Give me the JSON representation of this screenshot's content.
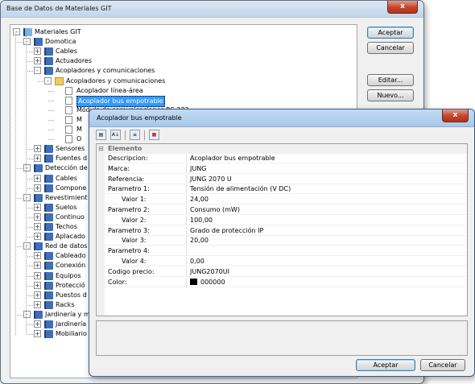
{
  "main_window": {
    "title": "Base de Datos de Materiales GIT",
    "close": "x",
    "buttons": {
      "accept": "Aceptar",
      "cancel": "Cancelar",
      "edit": "Editar...",
      "new": "Nuevo..."
    }
  },
  "tree": [
    {
      "label": "Materiales GIT",
      "level": 0,
      "icon": "root-book",
      "exp": "-"
    },
    {
      "label": "Domotica",
      "level": 1,
      "icon": "book",
      "exp": "-"
    },
    {
      "label": "Cables",
      "level": 2,
      "icon": "book",
      "exp": "+"
    },
    {
      "label": "Actuadores",
      "level": 2,
      "icon": "book",
      "exp": "+"
    },
    {
      "label": "Acopladores y comunicaciones",
      "level": 2,
      "icon": "book",
      "exp": "-"
    },
    {
      "label": "Acopladores y comunicaciones",
      "level": 3,
      "icon": "folder",
      "exp": "-"
    },
    {
      "label": "Acoplador línea-área",
      "level": 4,
      "icon": "doc",
      "exp": ""
    },
    {
      "label": "Acoplador bus empotrable",
      "level": 4,
      "icon": "doc",
      "exp": "",
      "selected": true
    },
    {
      "label": "Módulo de comunicaciones RS 232",
      "level": 4,
      "icon": "doc",
      "exp": ""
    },
    {
      "label": "M",
      "level": 4,
      "icon": "doc",
      "exp": ""
    },
    {
      "label": "M",
      "level": 4,
      "icon": "doc",
      "exp": ""
    },
    {
      "label": "O",
      "level": 4,
      "icon": "doc",
      "exp": ""
    },
    {
      "label": "Sensores",
      "level": 2,
      "icon": "book",
      "exp": "+"
    },
    {
      "label": "Fuentes d",
      "level": 2,
      "icon": "book",
      "exp": "+"
    },
    {
      "label": "Detección de",
      "level": 1,
      "icon": "book",
      "exp": "-"
    },
    {
      "label": "Cables",
      "level": 2,
      "icon": "book",
      "exp": "+"
    },
    {
      "label": "Compone",
      "level": 2,
      "icon": "book",
      "exp": "+"
    },
    {
      "label": "Revestimient",
      "level": 1,
      "icon": "book",
      "exp": "-"
    },
    {
      "label": "Suelos",
      "level": 2,
      "icon": "book",
      "exp": "+"
    },
    {
      "label": "Continuo",
      "level": 2,
      "icon": "book",
      "exp": "+"
    },
    {
      "label": "Techos",
      "level": 2,
      "icon": "book",
      "exp": "+"
    },
    {
      "label": "Aplacado",
      "level": 2,
      "icon": "book",
      "exp": "+"
    },
    {
      "label": "Red de datos",
      "level": 1,
      "icon": "book",
      "exp": "-"
    },
    {
      "label": "Cableado",
      "level": 2,
      "icon": "book",
      "exp": "+"
    },
    {
      "label": "Conexión",
      "level": 2,
      "icon": "book",
      "exp": "+"
    },
    {
      "label": "Equipos",
      "level": 2,
      "icon": "book",
      "exp": "+"
    },
    {
      "label": "Protecció",
      "level": 2,
      "icon": "book",
      "exp": "+"
    },
    {
      "label": "Puestos d",
      "level": 2,
      "icon": "book",
      "exp": "+"
    },
    {
      "label": "Racks",
      "level": 2,
      "icon": "book",
      "exp": "+"
    },
    {
      "label": "Jardinería y m",
      "level": 1,
      "icon": "book",
      "exp": "-"
    },
    {
      "label": "Jardinería",
      "level": 2,
      "icon": "book",
      "exp": "+"
    },
    {
      "label": "Mobiliario",
      "level": 2,
      "icon": "book",
      "exp": "+"
    }
  ],
  "dialog": {
    "title": "Acoplador bus empotrable",
    "close": "x",
    "category": "Elemento",
    "category_toggle": "⊟",
    "accept": "Aceptar",
    "cancel": "Cancelar",
    "toolbar": [
      "categorized-icon",
      "alphabetical-icon",
      "properties-icon",
      "palette-icon"
    ],
    "toolbar_glyphs": [
      "▤",
      "A↓",
      "≡",
      "■"
    ],
    "props": [
      {
        "k": "Descripcion:",
        "v": "Acoplador bus empotrable",
        "indent": false
      },
      {
        "k": "Marca:",
        "v": "JUNG",
        "indent": false
      },
      {
        "k": "Referencia:",
        "v": "JUNG 2070 U",
        "indent": false
      },
      {
        "k": "Parametro 1:",
        "v": "Tensión de alimentación (V DC)",
        "indent": false
      },
      {
        "k": "Valor 1:",
        "v": "24,00",
        "indent": true
      },
      {
        "k": "Parametro 2:",
        "v": "Consumo (mW)",
        "indent": false
      },
      {
        "k": "Valor 2:",
        "v": "100,00",
        "indent": true
      },
      {
        "k": "Parametro 3:",
        "v": "Grado de protección IP",
        "indent": false
      },
      {
        "k": "Valor 3:",
        "v": "20,00",
        "indent": true
      },
      {
        "k": "Parametro 4:",
        "v": "",
        "indent": false
      },
      {
        "k": "Valor 4:",
        "v": "0,00",
        "indent": true
      },
      {
        "k": "Codigo precio:",
        "v": "JUNG2070UI",
        "indent": false
      },
      {
        "k": "Color:",
        "v": "000000",
        "indent": false,
        "swatch": "#000000"
      }
    ]
  },
  "colors": {
    "selection": "#3399ff",
    "caption": "#c4d5ea",
    "close": "#c3432b"
  }
}
